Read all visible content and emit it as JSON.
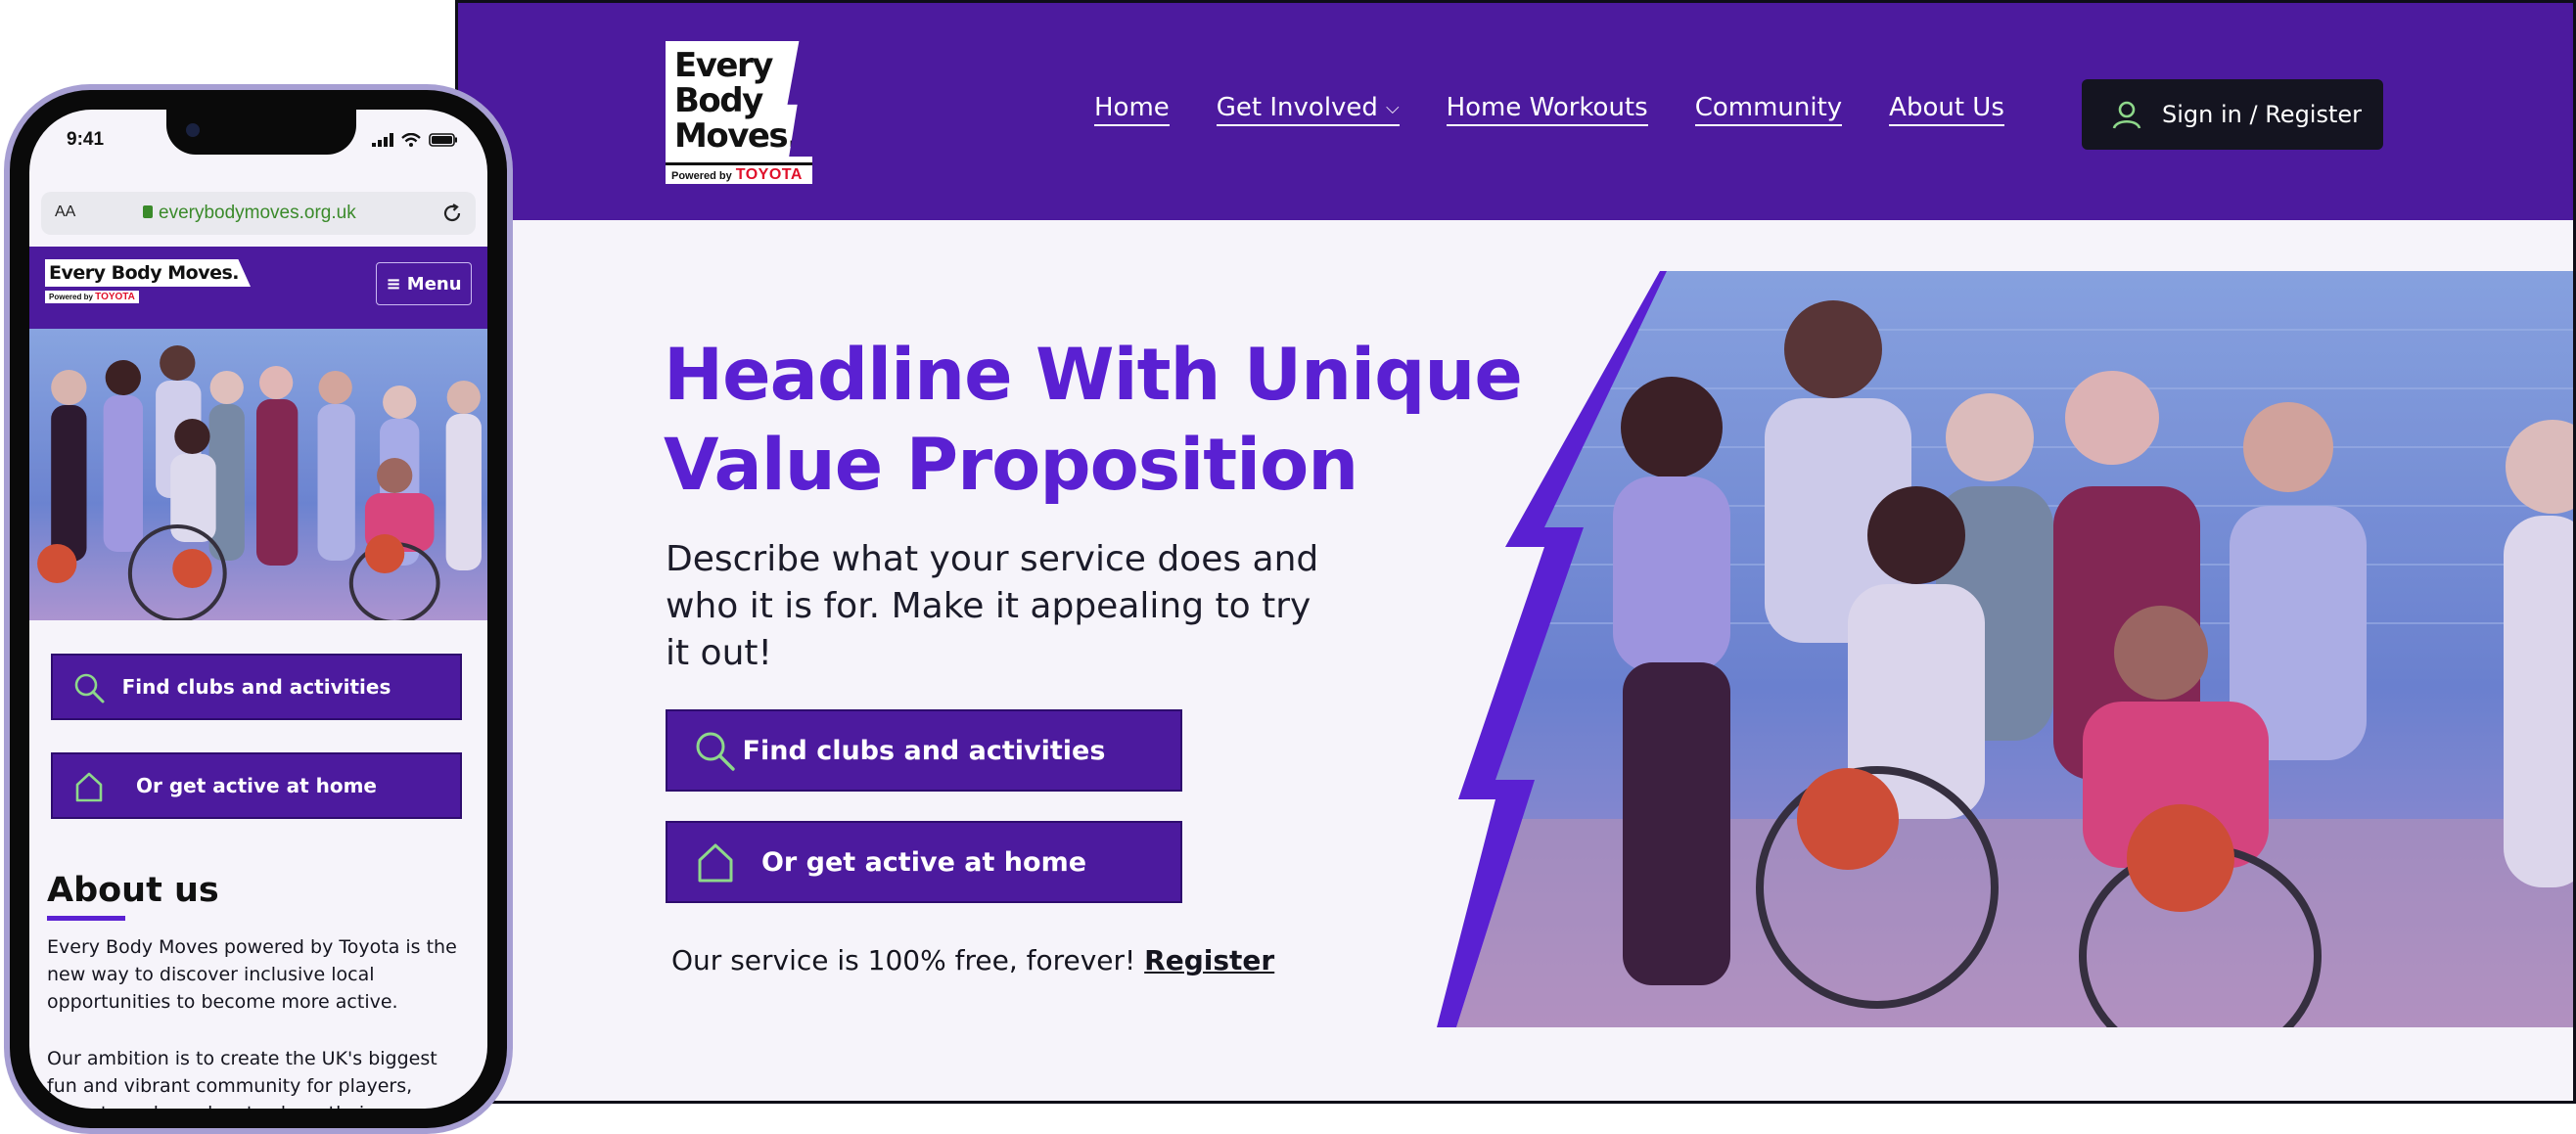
{
  "desktop": {
    "logo": {
      "line1": "Every",
      "line2": "Body",
      "line3": "Moves.",
      "powered_by": "Powered by",
      "brand": "TOYOTA"
    },
    "nav": [
      {
        "label": "Home"
      },
      {
        "label": "Get Involved"
      },
      {
        "label": "Home Workouts"
      },
      {
        "label": "Community"
      },
      {
        "label": "About Us"
      }
    ],
    "sign_in_label": "Sign in / Register",
    "headline": "Headline With Unique Value Proposition",
    "description": "Describe what your service does and who it is for. Make it appealing to try it out!",
    "find_clubs_label": "Find clubs and activities",
    "home_label": "Or get active at home",
    "free_text": "Our service is 100% free, forever!",
    "register_link": "Register"
  },
  "phone": {
    "time": "9:41",
    "url_aa": "AA",
    "url": "everybodymoves.org.uk",
    "logo_text": "Every Body Moves.",
    "powered_by": "Powered by",
    "brand": "TOYOTA",
    "menu_label": "≡ Menu",
    "find_clubs_label": "Find clubs and activities",
    "home_label": "Or get active at home",
    "about_heading": "About us",
    "about_para1": "Every Body Moves powered by Toyota is the new way to discover inclusive local opportunities to become more active.",
    "about_para2": "Our ambition is to create the UK's biggest fun and vibrant community for players, parents and coaches to share their experiences of para sport."
  },
  "colors": {
    "brand_purple": "#4c1a9e",
    "headline_purple": "#5a20d2",
    "accent_green": "#8ed88a",
    "dark_button": "#141420"
  },
  "icons": [
    "search-icon",
    "home-icon",
    "user-icon",
    "chevron-down-icon",
    "lock-icon",
    "reload-icon",
    "signal-icon",
    "wifi-icon",
    "battery-icon"
  ]
}
